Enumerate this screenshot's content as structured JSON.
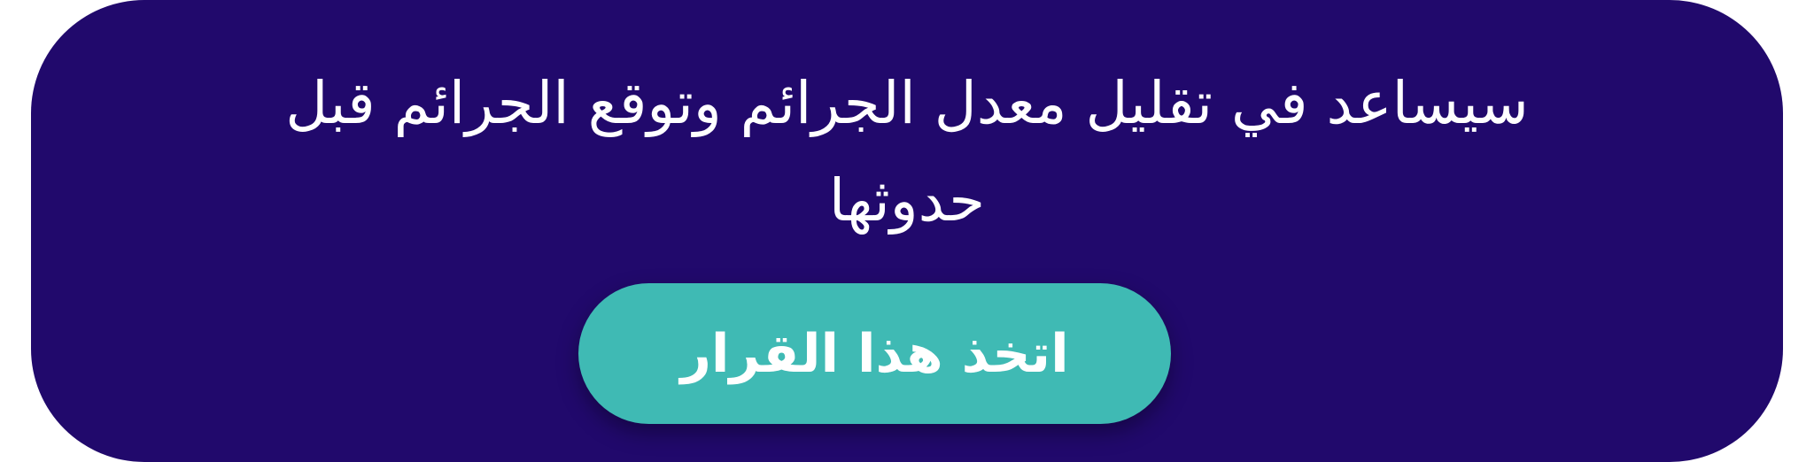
{
  "banner": {
    "message": "سيساعد في تقليل معدل الجرائم وتوقع الجرائم قبل حدوثها",
    "cta_label": "اتخذ هذا القرار"
  },
  "colors": {
    "background": "#21096c",
    "button": "#3fbab4",
    "text": "#ffffff"
  }
}
